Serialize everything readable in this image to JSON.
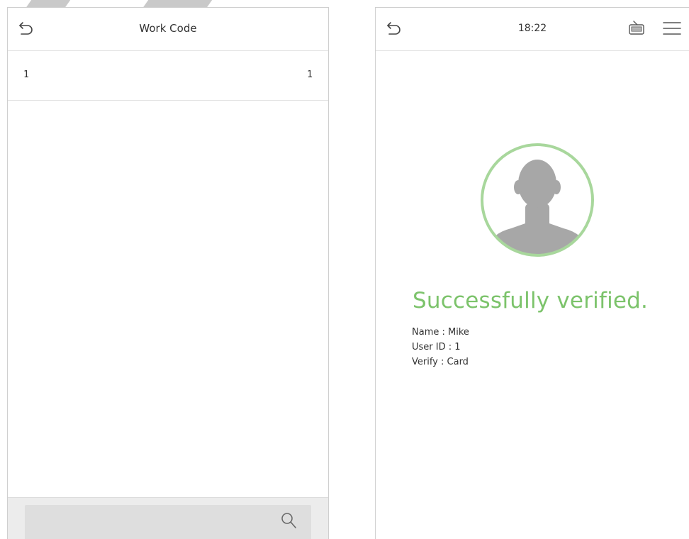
{
  "left_screen": {
    "header": {
      "title": "Work Code"
    },
    "list": [
      {
        "left": "1",
        "right": "1"
      }
    ],
    "search": {
      "value": ""
    }
  },
  "right_screen": {
    "header": {
      "time": "18:22"
    },
    "status": {
      "message": "Successfully verified.",
      "color": "#7cc36b"
    },
    "info": {
      "name": "Name : Mike",
      "user_id": "User ID : 1",
      "verify": "Verify : Card"
    }
  },
  "icons": [
    "back-arrow-icon",
    "search-icon",
    "keyboard-icon",
    "menu-icon",
    "user-avatar-icon"
  ]
}
